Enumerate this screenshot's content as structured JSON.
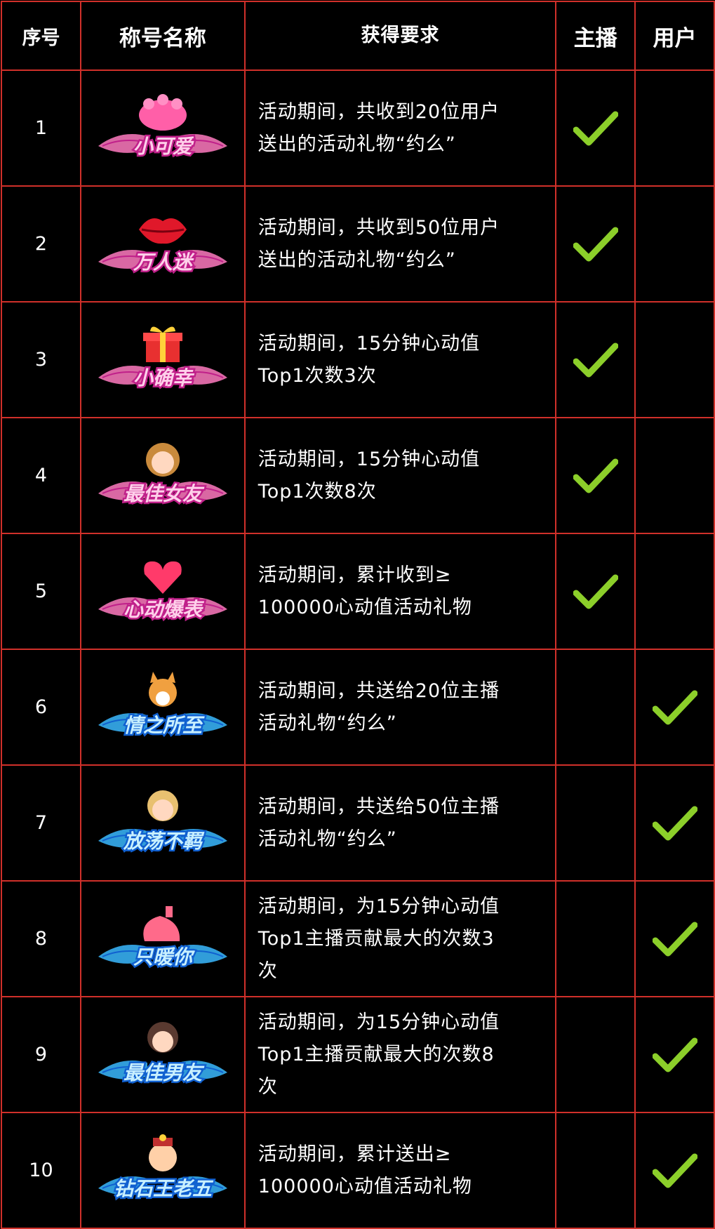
{
  "headers": {
    "num": "序号",
    "title": "称号名称",
    "req": "获得要求",
    "host": "主播",
    "user": "用户"
  },
  "colors": {
    "border": "#d0302a",
    "check": "#8ccf2a",
    "pink_badge": "#ff4fa3",
    "blue_badge": "#28b4ff"
  },
  "rows": [
    {
      "num": "1",
      "title": "小可爱",
      "theme": "pink",
      "icon": "paw-icon",
      "req_lines": [
        "活动期间，共收到20位用户",
        "送出的活动礼物“约么”"
      ],
      "host": true,
      "user": false
    },
    {
      "num": "2",
      "title": "万人迷",
      "theme": "pink",
      "icon": "lips-icon",
      "req_lines": [
        "活动期间，共收到50位用户",
        "送出的活动礼物“约么”"
      ],
      "host": true,
      "user": false
    },
    {
      "num": "3",
      "title": "小确幸",
      "theme": "pink",
      "icon": "gift-box-icon",
      "req_lines": [
        "活动期间，15分钟心动值",
        "Top1次数3次"
      ],
      "host": true,
      "user": false
    },
    {
      "num": "4",
      "title": "最佳女友",
      "theme": "pink",
      "icon": "girl-avatar-icon",
      "req_lines": [
        "活动期间，15分钟心动值",
        "Top1次数8次"
      ],
      "host": true,
      "user": false
    },
    {
      "num": "5",
      "title": "心动爆表",
      "theme": "pink",
      "icon": "heart-icon",
      "req_lines": [
        "活动期间，累计收到≥",
        "100000心动值活动礼物"
      ],
      "host": true,
      "user": false
    },
    {
      "num": "6",
      "title": "情之所至",
      "theme": "blue",
      "icon": "corgi-icon",
      "req_lines": [
        "活动期间，共送给20位主播",
        "活动礼物“约么”"
      ],
      "host": false,
      "user": true
    },
    {
      "num": "7",
      "title": "放荡不羁",
      "theme": "blue",
      "icon": "boy-avatar-icon",
      "req_lines": [
        "活动期间，共送给50位主播",
        "活动礼物“约么”"
      ],
      "host": false,
      "user": true
    },
    {
      "num": "8",
      "title": "只暖你",
      "theme": "blue",
      "icon": "hot-water-bottle-icon",
      "req_lines": [
        "活动期间，为15分钟心动值",
        "Top1主播贡献最大的次数3",
        "次"
      ],
      "host": false,
      "user": true
    },
    {
      "num": "9",
      "title": "最佳男友",
      "theme": "blue",
      "icon": "man-avatar-icon",
      "req_lines": [
        "活动期间，为15分钟心动值",
        "Top1主播贡献最大的次数8",
        "次"
      ],
      "host": false,
      "user": true
    },
    {
      "num": "10",
      "title": "钻石王老五",
      "theme": "blue",
      "icon": "rich-man-avatar-icon",
      "req_lines": [
        "活动期间，累计送出≥",
        "100000心动值活动礼物"
      ],
      "host": false,
      "user": true
    }
  ]
}
